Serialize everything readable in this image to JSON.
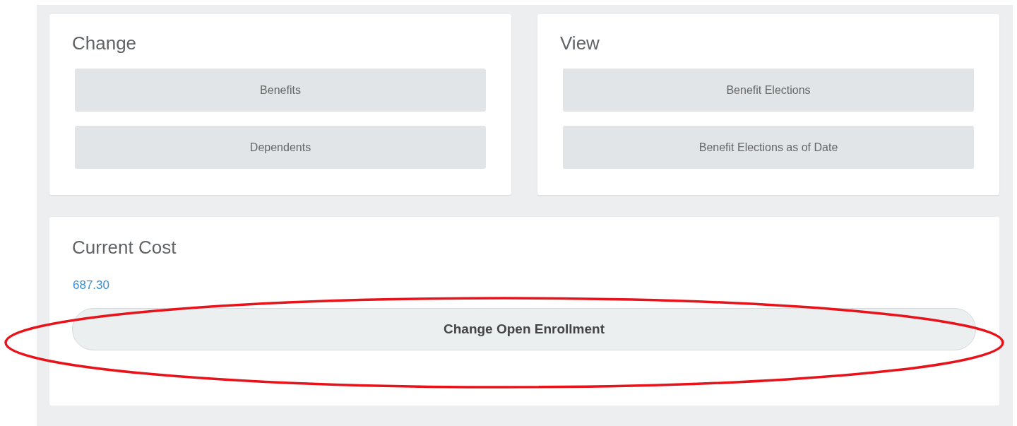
{
  "change_card": {
    "title": "Change",
    "buttons": [
      "Benefits",
      "Dependents"
    ]
  },
  "view_card": {
    "title": "View",
    "buttons": [
      "Benefit Elections",
      "Benefit Elections as of Date"
    ]
  },
  "cost_card": {
    "title": "Current Cost",
    "amount": "687.30",
    "button": {
      "label": "Change Open Enrollment",
      "highlighted": true
    }
  }
}
